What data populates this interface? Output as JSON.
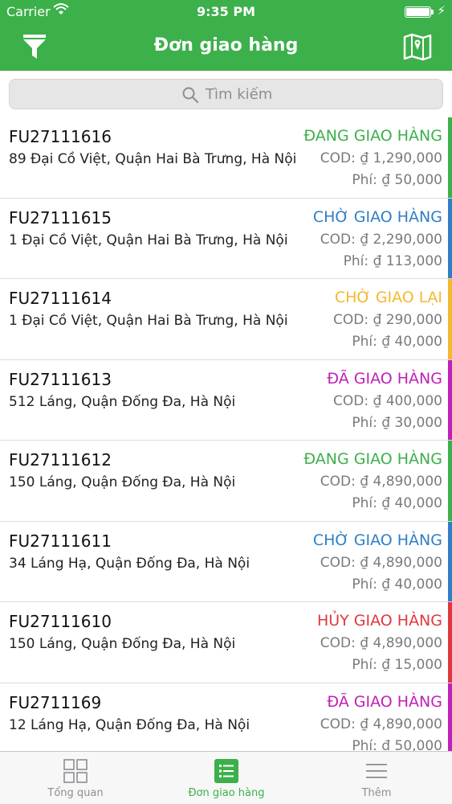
{
  "status_bar": {
    "carrier": "Carrier",
    "time": "9:35 PM",
    "battery_level": 1.0
  },
  "nav": {
    "title": "Đơn giao hàng",
    "left_icon": "filter-icon",
    "right_icon": "map-icon"
  },
  "search": {
    "placeholder": "Tìm kiếm"
  },
  "orders": [
    {
      "code": "FU27111616",
      "address": "89 Đại Cồ Việt, Quận Hai Bà Trưng, Hà Nội",
      "status": "ĐANG GIAO HÀNG",
      "cod": "COD: ₫ 1,290,000",
      "fee": "Phí: ₫ 50,000",
      "color": "#3cb04a"
    },
    {
      "code": "FU27111615",
      "address": "1 Đại Cồ Việt, Quận Hai Bà Trưng, Hà Nội",
      "status": "CHỜ GIAO HÀNG",
      "cod": "COD: ₫ 2,290,000",
      "fee": "Phí: ₫ 113,000",
      "color": "#2f7fc6"
    },
    {
      "code": "FU27111614",
      "address": "1 Đại Cồ Việt, Quận Hai Bà Trưng, Hà Nội",
      "status": "CHỜ GIAO LẠI",
      "cod": "COD: ₫ 290,000",
      "fee": "Phí: ₫ 40,000",
      "color": "#f5b82e"
    },
    {
      "code": "FU27111613",
      "address": "512 Láng, Quận Đống Đa, Hà Nội",
      "status": "ĐÃ GIAO HÀNG",
      "cod": "COD: ₫ 400,000",
      "fee": "Phí: ₫ 30,000",
      "color": "#c020b8"
    },
    {
      "code": "FU27111612",
      "address": "150 Láng, Quận Đống Đa, Hà Nội",
      "status": "ĐANG GIAO HÀNG",
      "cod": "COD: ₫ 4,890,000",
      "fee": "Phí: ₫ 40,000",
      "color": "#3cb04a"
    },
    {
      "code": "FU27111611",
      "address": "34 Láng Hạ, Quận Đống Đa, Hà Nội",
      "status": "CHỜ GIAO HÀNG",
      "cod": "COD: ₫ 4,890,000",
      "fee": "Phí: ₫ 40,000",
      "color": "#2f7fc6"
    },
    {
      "code": "FU27111610",
      "address": "150 Láng, Quận Đống Đa, Hà Nội",
      "status": "HỦY GIAO HÀNG",
      "cod": "COD: ₫ 4,890,000",
      "fee": "Phí: ₫ 15,000",
      "color": "#e0383e"
    },
    {
      "code": "FU2711169",
      "address": "12 Láng Hạ, Quận Đống Đa, Hà Nội",
      "status": "ĐÃ GIAO HÀNG",
      "cod": "COD: ₫ 4,890,000",
      "fee": "Phí: ₫ 50,000",
      "color": "#c020b8"
    }
  ],
  "tabs": [
    {
      "label": "Tổng quan",
      "icon": "grid-icon",
      "active": false
    },
    {
      "label": "Đơn giao hàng",
      "icon": "list-icon",
      "active": true
    },
    {
      "label": "Thêm",
      "icon": "menu-icon",
      "active": false
    }
  ],
  "colors": {
    "brand": "#3cb04a",
    "inactive": "#8e8e93"
  }
}
